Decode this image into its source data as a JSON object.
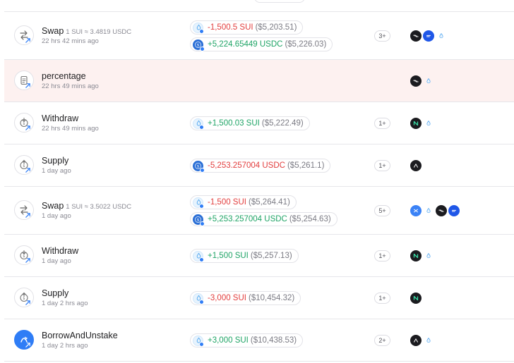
{
  "rows": [
    {
      "title": "Swap",
      "subtitle": "1 SUI ≈ 3.4819 USDC",
      "time": "22 hrs 42 mins ago",
      "amounts": [
        {
          "coin": "sui",
          "value": "-1,500.5 SUI",
          "usd": "($5,203.51)",
          "sign": "neg"
        },
        {
          "coin": "usdc",
          "value": "+5,224.65449 USDC",
          "usd": "($5,226.03)",
          "sign": "pos"
        }
      ],
      "count": "3+",
      "icon": "swap-icon",
      "protocols": [
        "dark-stripes-logo",
        "navy-dash-logo",
        "sui-drop-logo"
      ]
    },
    {
      "title": "percentage",
      "subtitle": "",
      "time": "22 hrs 49 mins ago",
      "amounts": [],
      "count": "",
      "icon": "document-icon",
      "protocols": [
        "dark-stripes-logo",
        "sui-drop-logo"
      ],
      "highlight": true
    },
    {
      "title": "Withdraw",
      "subtitle": "",
      "time": "22 hrs 49 mins ago",
      "amounts": [
        {
          "coin": "sui",
          "value": "+1,500.03 SUI",
          "usd": "($5,222.49)",
          "sign": "pos"
        }
      ],
      "count": "1+",
      "icon": "withdraw-icon",
      "protocols": [
        "navi-logo",
        "sui-drop-logo"
      ]
    },
    {
      "title": "Supply",
      "subtitle": "",
      "time": "1 day ago",
      "amounts": [
        {
          "coin": "usdc",
          "value": "-5,253.257004 USDC",
          "usd": "($5,261.1)",
          "sign": "neg"
        }
      ],
      "count": "1+",
      "icon": "supply-icon",
      "protocols": [
        "arrow-protocol-logo"
      ]
    },
    {
      "title": "Swap",
      "subtitle": "1 SUI ≈ 3.5022 USDC",
      "time": "1 day ago",
      "amounts": [
        {
          "coin": "sui",
          "value": "-1,500 SUI",
          "usd": "($5,264.41)",
          "sign": "neg"
        },
        {
          "coin": "usdc",
          "value": "+5,253.257004 USDC",
          "usd": "($5,254.63)",
          "sign": "pos"
        }
      ],
      "count": "5+",
      "icon": "swap-icon",
      "protocols": [
        "blue-x-logo",
        "sui-drop-logo",
        "dark-stripes-logo",
        "navy-dash-logo"
      ]
    },
    {
      "title": "Withdraw",
      "subtitle": "",
      "time": "1 day ago",
      "amounts": [
        {
          "coin": "sui",
          "value": "+1,500 SUI",
          "usd": "($5,257.13)",
          "sign": "pos"
        }
      ],
      "count": "1+",
      "icon": "withdraw-icon",
      "protocols": [
        "navi-logo",
        "sui-drop-logo"
      ]
    },
    {
      "title": "Supply",
      "subtitle": "",
      "time": "1 day 2 hrs ago",
      "amounts": [
        {
          "coin": "sui",
          "value": "-3,000 SUI",
          "usd": "($10,454.32)",
          "sign": "neg"
        }
      ],
      "count": "1+",
      "icon": "supply-icon",
      "protocols": [
        "navi-logo"
      ]
    },
    {
      "title": "BorrowAndUnstake",
      "subtitle": "",
      "time": "1 day 2 hrs ago",
      "amounts": [
        {
          "coin": "sui",
          "value": "+3,000 SUI",
          "usd": "($10,438.53)",
          "sign": "pos"
        }
      ],
      "count": "2+",
      "icon": "borrow-unstake-icon",
      "protocols": [
        "arrow-protocol-logo",
        "sui-drop-logo"
      ]
    }
  ]
}
